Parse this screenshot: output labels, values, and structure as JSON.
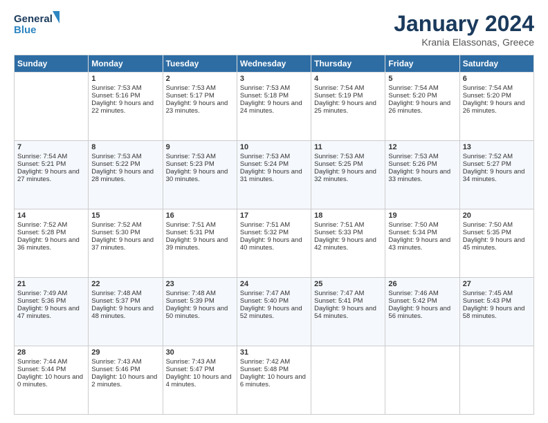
{
  "logo": {
    "line1": "General",
    "line2": "Blue"
  },
  "title": "January 2024",
  "subtitle": "Krania Elassonas, Greece",
  "headers": [
    "Sunday",
    "Monday",
    "Tuesday",
    "Wednesday",
    "Thursday",
    "Friday",
    "Saturday"
  ],
  "weeks": [
    [
      {
        "day": "",
        "sunrise": "",
        "sunset": "",
        "daylight": ""
      },
      {
        "day": "1",
        "sunrise": "Sunrise: 7:53 AM",
        "sunset": "Sunset: 5:16 PM",
        "daylight": "Daylight: 9 hours and 22 minutes."
      },
      {
        "day": "2",
        "sunrise": "Sunrise: 7:53 AM",
        "sunset": "Sunset: 5:17 PM",
        "daylight": "Daylight: 9 hours and 23 minutes."
      },
      {
        "day": "3",
        "sunrise": "Sunrise: 7:53 AM",
        "sunset": "Sunset: 5:18 PM",
        "daylight": "Daylight: 9 hours and 24 minutes."
      },
      {
        "day": "4",
        "sunrise": "Sunrise: 7:54 AM",
        "sunset": "Sunset: 5:19 PM",
        "daylight": "Daylight: 9 hours and 25 minutes."
      },
      {
        "day": "5",
        "sunrise": "Sunrise: 7:54 AM",
        "sunset": "Sunset: 5:20 PM",
        "daylight": "Daylight: 9 hours and 26 minutes."
      },
      {
        "day": "6",
        "sunrise": "Sunrise: 7:54 AM",
        "sunset": "Sunset: 5:20 PM",
        "daylight": "Daylight: 9 hours and 26 minutes."
      }
    ],
    [
      {
        "day": "7",
        "sunrise": "Sunrise: 7:54 AM",
        "sunset": "Sunset: 5:21 PM",
        "daylight": "Daylight: 9 hours and 27 minutes."
      },
      {
        "day": "8",
        "sunrise": "Sunrise: 7:53 AM",
        "sunset": "Sunset: 5:22 PM",
        "daylight": "Daylight: 9 hours and 28 minutes."
      },
      {
        "day": "9",
        "sunrise": "Sunrise: 7:53 AM",
        "sunset": "Sunset: 5:23 PM",
        "daylight": "Daylight: 9 hours and 30 minutes."
      },
      {
        "day": "10",
        "sunrise": "Sunrise: 7:53 AM",
        "sunset": "Sunset: 5:24 PM",
        "daylight": "Daylight: 9 hours and 31 minutes."
      },
      {
        "day": "11",
        "sunrise": "Sunrise: 7:53 AM",
        "sunset": "Sunset: 5:25 PM",
        "daylight": "Daylight: 9 hours and 32 minutes."
      },
      {
        "day": "12",
        "sunrise": "Sunrise: 7:53 AM",
        "sunset": "Sunset: 5:26 PM",
        "daylight": "Daylight: 9 hours and 33 minutes."
      },
      {
        "day": "13",
        "sunrise": "Sunrise: 7:52 AM",
        "sunset": "Sunset: 5:27 PM",
        "daylight": "Daylight: 9 hours and 34 minutes."
      }
    ],
    [
      {
        "day": "14",
        "sunrise": "Sunrise: 7:52 AM",
        "sunset": "Sunset: 5:28 PM",
        "daylight": "Daylight: 9 hours and 36 minutes."
      },
      {
        "day": "15",
        "sunrise": "Sunrise: 7:52 AM",
        "sunset": "Sunset: 5:30 PM",
        "daylight": "Daylight: 9 hours and 37 minutes."
      },
      {
        "day": "16",
        "sunrise": "Sunrise: 7:51 AM",
        "sunset": "Sunset: 5:31 PM",
        "daylight": "Daylight: 9 hours and 39 minutes."
      },
      {
        "day": "17",
        "sunrise": "Sunrise: 7:51 AM",
        "sunset": "Sunset: 5:32 PM",
        "daylight": "Daylight: 9 hours and 40 minutes."
      },
      {
        "day": "18",
        "sunrise": "Sunrise: 7:51 AM",
        "sunset": "Sunset: 5:33 PM",
        "daylight": "Daylight: 9 hours and 42 minutes."
      },
      {
        "day": "19",
        "sunrise": "Sunrise: 7:50 AM",
        "sunset": "Sunset: 5:34 PM",
        "daylight": "Daylight: 9 hours and 43 minutes."
      },
      {
        "day": "20",
        "sunrise": "Sunrise: 7:50 AM",
        "sunset": "Sunset: 5:35 PM",
        "daylight": "Daylight: 9 hours and 45 minutes."
      }
    ],
    [
      {
        "day": "21",
        "sunrise": "Sunrise: 7:49 AM",
        "sunset": "Sunset: 5:36 PM",
        "daylight": "Daylight: 9 hours and 47 minutes."
      },
      {
        "day": "22",
        "sunrise": "Sunrise: 7:48 AM",
        "sunset": "Sunset: 5:37 PM",
        "daylight": "Daylight: 9 hours and 48 minutes."
      },
      {
        "day": "23",
        "sunrise": "Sunrise: 7:48 AM",
        "sunset": "Sunset: 5:39 PM",
        "daylight": "Daylight: 9 hours and 50 minutes."
      },
      {
        "day": "24",
        "sunrise": "Sunrise: 7:47 AM",
        "sunset": "Sunset: 5:40 PM",
        "daylight": "Daylight: 9 hours and 52 minutes."
      },
      {
        "day": "25",
        "sunrise": "Sunrise: 7:47 AM",
        "sunset": "Sunset: 5:41 PM",
        "daylight": "Daylight: 9 hours and 54 minutes."
      },
      {
        "day": "26",
        "sunrise": "Sunrise: 7:46 AM",
        "sunset": "Sunset: 5:42 PM",
        "daylight": "Daylight: 9 hours and 56 minutes."
      },
      {
        "day": "27",
        "sunrise": "Sunrise: 7:45 AM",
        "sunset": "Sunset: 5:43 PM",
        "daylight": "Daylight: 9 hours and 58 minutes."
      }
    ],
    [
      {
        "day": "28",
        "sunrise": "Sunrise: 7:44 AM",
        "sunset": "Sunset: 5:44 PM",
        "daylight": "Daylight: 10 hours and 0 minutes."
      },
      {
        "day": "29",
        "sunrise": "Sunrise: 7:43 AM",
        "sunset": "Sunset: 5:46 PM",
        "daylight": "Daylight: 10 hours and 2 minutes."
      },
      {
        "day": "30",
        "sunrise": "Sunrise: 7:43 AM",
        "sunset": "Sunset: 5:47 PM",
        "daylight": "Daylight: 10 hours and 4 minutes."
      },
      {
        "day": "31",
        "sunrise": "Sunrise: 7:42 AM",
        "sunset": "Sunset: 5:48 PM",
        "daylight": "Daylight: 10 hours and 6 minutes."
      },
      {
        "day": "",
        "sunrise": "",
        "sunset": "",
        "daylight": ""
      },
      {
        "day": "",
        "sunrise": "",
        "sunset": "",
        "daylight": ""
      },
      {
        "day": "",
        "sunrise": "",
        "sunset": "",
        "daylight": ""
      }
    ]
  ]
}
